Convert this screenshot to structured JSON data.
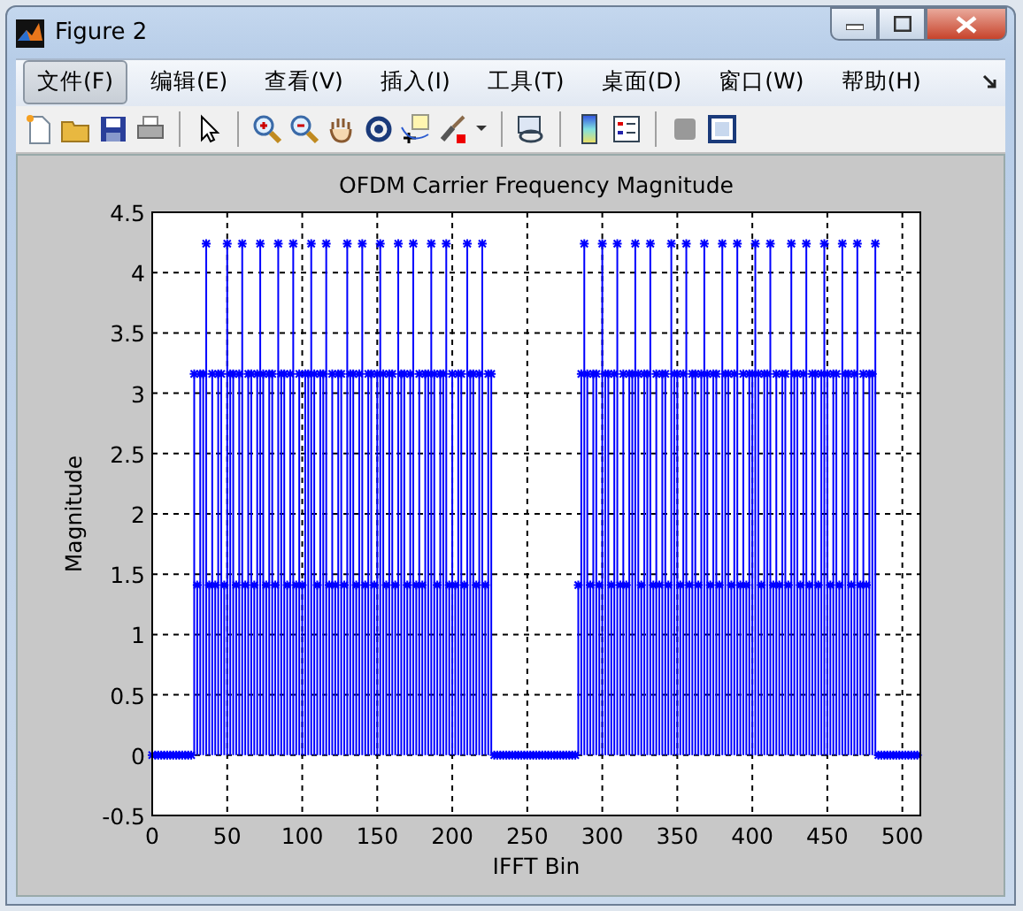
{
  "window": {
    "title": "Figure 2"
  },
  "menu": [
    {
      "label": "文件(F)",
      "selected": true
    },
    {
      "label": "编辑(E)",
      "selected": false
    },
    {
      "label": "查看(V)",
      "selected": false
    },
    {
      "label": "插入(I)",
      "selected": false
    },
    {
      "label": "工具(T)",
      "selected": false
    },
    {
      "label": "桌面(D)",
      "selected": false
    },
    {
      "label": "窗口(W)",
      "selected": false
    },
    {
      "label": "帮助(H)",
      "selected": false
    }
  ],
  "figure": {
    "chart_data": {
      "type": "bar",
      "title": "OFDM Carrier Frequency Magnitude",
      "xlabel": "IFFT Bin",
      "ylabel": "Magnitude",
      "xlim": [
        0,
        512
      ],
      "ylim": [
        -0.5,
        4.5
      ],
      "grid": true,
      "xticks": [
        0,
        50,
        100,
        150,
        200,
        250,
        300,
        350,
        400,
        450,
        500
      ],
      "yticks": [
        -0.5,
        0,
        0.5,
        1,
        1.5,
        2,
        2.5,
        3,
        3.5,
        4,
        4.5
      ],
      "x": [
        0,
        2,
        4,
        6,
        8,
        10,
        12,
        14,
        16,
        18,
        20,
        22,
        24,
        26,
        28,
        30,
        32,
        34,
        36,
        38,
        40,
        42,
        44,
        46,
        48,
        50,
        52,
        54,
        56,
        58,
        60,
        62,
        64,
        66,
        68,
        70,
        72,
        74,
        76,
        78,
        80,
        82,
        84,
        86,
        88,
        90,
        92,
        94,
        96,
        98,
        100,
        102,
        104,
        106,
        108,
        110,
        112,
        114,
        116,
        118,
        120,
        122,
        124,
        126,
        128,
        130,
        132,
        134,
        136,
        138,
        140,
        142,
        144,
        146,
        148,
        150,
        152,
        154,
        156,
        158,
        160,
        162,
        164,
        166,
        168,
        170,
        172,
        174,
        176,
        178,
        180,
        182,
        184,
        186,
        188,
        190,
        192,
        194,
        196,
        198,
        200,
        202,
        204,
        206,
        208,
        210,
        212,
        214,
        216,
        218,
        220,
        222,
        224,
        226,
        228,
        230,
        232,
        234,
        236,
        238,
        240,
        242,
        244,
        246,
        248,
        250,
        252,
        254,
        256,
        258,
        260,
        262,
        264,
        266,
        268,
        270,
        272,
        274,
        276,
        278,
        280,
        282,
        284,
        286,
        288,
        290,
        292,
        294,
        296,
        298,
        300,
        302,
        304,
        306,
        308,
        310,
        312,
        314,
        316,
        318,
        320,
        322,
        324,
        326,
        328,
        330,
        332,
        334,
        336,
        338,
        340,
        342,
        344,
        346,
        348,
        350,
        352,
        354,
        356,
        358,
        360,
        362,
        364,
        366,
        368,
        370,
        372,
        374,
        376,
        378,
        380,
        382,
        384,
        386,
        388,
        390,
        392,
        394,
        396,
        398,
        400,
        402,
        404,
        406,
        408,
        410,
        412,
        414,
        416,
        418,
        420,
        422,
        424,
        426,
        428,
        430,
        432,
        434,
        436,
        438,
        440,
        442,
        444,
        446,
        448,
        450,
        452,
        454,
        456,
        458,
        460,
        462,
        464,
        466,
        468,
        470,
        472,
        474,
        476,
        478,
        480,
        482,
        484,
        486,
        488,
        490,
        492,
        494,
        496,
        498,
        500,
        502,
        504,
        506,
        508,
        510
      ],
      "series": [
        {
          "color": "#0000ff",
          "values": [
            0,
            0,
            0,
            0,
            0,
            0,
            0,
            0,
            0,
            0,
            0,
            0,
            0,
            0,
            3.16,
            1.41,
            3.16,
            3.16,
            4.24,
            1.41,
            3.16,
            1.41,
            3.16,
            3.16,
            1.41,
            4.24,
            3.16,
            3.16,
            1.41,
            3.16,
            4.24,
            1.41,
            3.16,
            3.16,
            1.41,
            3.16,
            4.24,
            3.16,
            1.41,
            3.16,
            3.16,
            1.41,
            4.24,
            3.16,
            3.16,
            1.41,
            3.16,
            4.24,
            1.41,
            3.16,
            1.41,
            3.16,
            3.16,
            4.24,
            3.16,
            1.41,
            3.16,
            3.16,
            4.24,
            1.41,
            3.16,
            1.41,
            3.16,
            3.16,
            1.41,
            4.24,
            3.16,
            3.16,
            1.41,
            3.16,
            4.24,
            1.41,
            3.16,
            3.16,
            1.41,
            3.16,
            4.24,
            3.16,
            1.41,
            3.16,
            3.16,
            1.41,
            4.24,
            3.16,
            3.16,
            1.41,
            3.16,
            4.24,
            1.41,
            3.16,
            1.41,
            3.16,
            3.16,
            4.24,
            3.16,
            1.41,
            3.16,
            3.16,
            4.24,
            1.41,
            3.16,
            1.41,
            3.16,
            3.16,
            1.41,
            4.24,
            3.16,
            3.16,
            1.41,
            3.16,
            4.24,
            1.41,
            3.16,
            3.16,
            0,
            0,
            0,
            0,
            0,
            0,
            0,
            0,
            0,
            0,
            0,
            0,
            0,
            0,
            0,
            0,
            0,
            0,
            0,
            0,
            0,
            0,
            0,
            0,
            0,
            0,
            0,
            0,
            1.41,
            3.16,
            4.24,
            3.16,
            1.41,
            3.16,
            3.16,
            1.41,
            4.24,
            3.16,
            3.16,
            1.41,
            3.16,
            4.24,
            1.41,
            3.16,
            1.41,
            3.16,
            3.16,
            4.24,
            3.16,
            1.41,
            3.16,
            3.16,
            4.24,
            1.41,
            3.16,
            1.41,
            3.16,
            3.16,
            1.41,
            4.24,
            3.16,
            3.16,
            1.41,
            3.16,
            4.24,
            1.41,
            3.16,
            3.16,
            1.41,
            3.16,
            4.24,
            3.16,
            1.41,
            3.16,
            3.16,
            1.41,
            4.24,
            3.16,
            3.16,
            1.41,
            3.16,
            4.24,
            1.41,
            3.16,
            1.41,
            3.16,
            3.16,
            4.24,
            3.16,
            1.41,
            3.16,
            3.16,
            4.24,
            1.41,
            3.16,
            1.41,
            3.16,
            3.16,
            1.41,
            4.24,
            3.16,
            3.16,
            1.41,
            3.16,
            4.24,
            1.41,
            3.16,
            3.16,
            1.41,
            3.16,
            4.24,
            3.16,
            1.41,
            3.16,
            3.16,
            1.41,
            4.24,
            3.16,
            3.16,
            1.41,
            3.16,
            4.24,
            1.41,
            3.16,
            1.41,
            3.16,
            3.16,
            4.24,
            0,
            0,
            0,
            0,
            0,
            0,
            0,
            0,
            0,
            0,
            0,
            0,
            0,
            0
          ]
        }
      ]
    }
  }
}
